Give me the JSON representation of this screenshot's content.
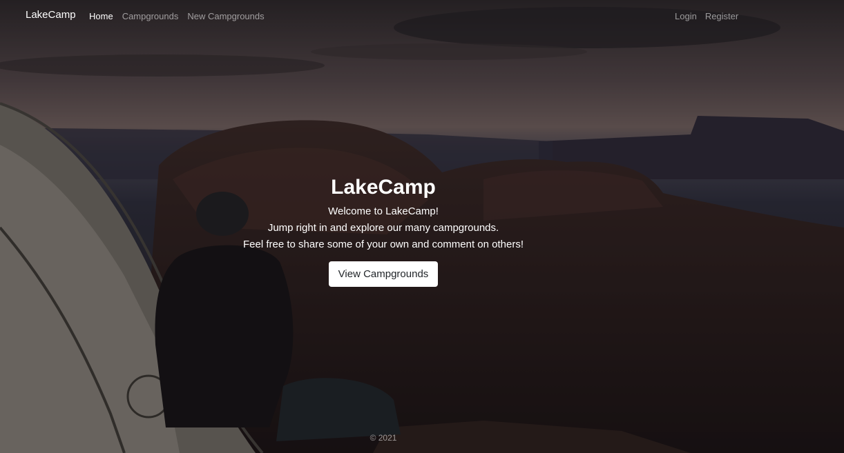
{
  "navbar": {
    "brand": "LakeCamp",
    "links": [
      {
        "label": "Home",
        "active": true
      },
      {
        "label": "Campgrounds",
        "active": false
      },
      {
        "label": "New Campgrounds",
        "active": false
      }
    ],
    "auth_links": [
      {
        "label": "Login"
      },
      {
        "label": "Register"
      }
    ]
  },
  "hero": {
    "title": "LakeCamp",
    "lines": [
      "Welcome to LakeCamp!",
      "Jump right in and explore our many campgrounds.",
      "Feel free to share some of your own and comment on others!"
    ],
    "button_label": "View Campgrounds"
  },
  "footer": {
    "copyright": "© 2021"
  },
  "colors": {
    "text_primary": "#ffffff",
    "text_muted": "rgba(255,255,255,0.55)",
    "button_bg": "#ffffff",
    "button_text": "#212529"
  }
}
